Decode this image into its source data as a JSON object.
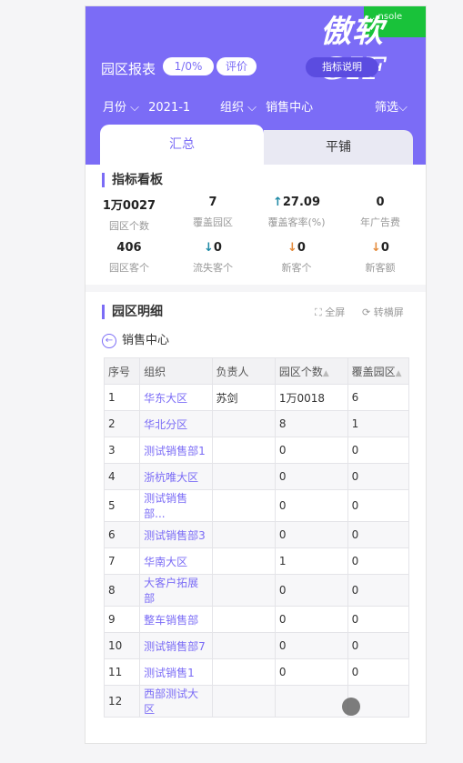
{
  "header": {
    "watermark": "傲软GIF",
    "green_tag": "...nsole",
    "title": "园区报表",
    "pill_ratio": "1/0%",
    "pill_eval": "评价",
    "guide_button": "指标说明",
    "filter_month_label": "月份 ⌵",
    "filter_month_value": "2021-1",
    "filter_org_label": "组织 ⌵",
    "filter_org_value": "销售中心",
    "filter_screen": "筛选⌵",
    "colors": {
      "primary": "#7b6cf6",
      "button": "#5b4ce0"
    }
  },
  "tabs": {
    "summary": "汇总",
    "tile": "平铺"
  },
  "kpi_board": {
    "title": "指标看板",
    "items": [
      {
        "value": "1万0027",
        "label": "园区个数",
        "arrow": ""
      },
      {
        "value": "7",
        "label": "覆盖园区",
        "arrow": ""
      },
      {
        "value": "27.09",
        "label": "覆盖客率(%)",
        "arrow": "↑"
      },
      {
        "value": "0",
        "label": "年广告费",
        "arrow": ""
      },
      {
        "value": "406",
        "label": "园区客个",
        "arrow": ""
      },
      {
        "value": "0",
        "label": "流失客个",
        "arrow": "↓"
      },
      {
        "value": "0",
        "label": "新客个",
        "arrow": "↓"
      },
      {
        "value": "0",
        "label": "新客额",
        "arrow": "↓"
      }
    ]
  },
  "detail": {
    "title": "园区明细",
    "fullscreen": "⛶ 全屏",
    "rotate": "⟳ 转横屏",
    "back_label": "销售中心",
    "columns": [
      "序号",
      "组织",
      "负责人",
      "园区个数",
      "覆盖园区"
    ],
    "rows": [
      [
        "1",
        "华东大区",
        "苏剑",
        "1万0018",
        "6"
      ],
      [
        "2",
        "华北分区",
        "",
        "8",
        "1"
      ],
      [
        "3",
        "测试销售部1",
        "",
        "0",
        "0"
      ],
      [
        "4",
        "浙杭唯大区",
        "",
        "0",
        "0"
      ],
      [
        "5",
        "测试销售部...",
        "",
        "0",
        "0"
      ],
      [
        "6",
        "测试销售部3",
        "",
        "0",
        "0"
      ],
      [
        "7",
        "华南大区",
        "",
        "1",
        "0"
      ],
      [
        "8",
        "大客户拓展部",
        "",
        "0",
        "0"
      ],
      [
        "9",
        "整车销售部",
        "",
        "0",
        "0"
      ],
      [
        "10",
        "测试销售部7",
        "",
        "0",
        "0"
      ],
      [
        "11",
        "测试销售1",
        "",
        "0",
        "0"
      ],
      [
        "12",
        "西部测试大区",
        "",
        "",
        ""
      ]
    ]
  }
}
